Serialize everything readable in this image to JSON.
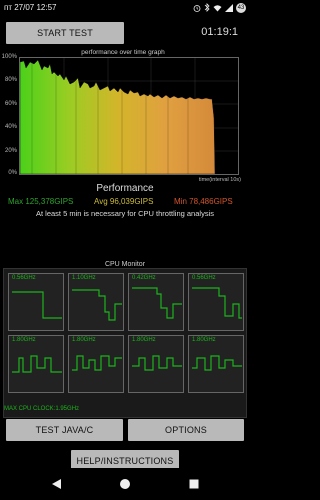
{
  "status_bar": {
    "time": "пт 27/07 12:57",
    "battery": "43",
    "icons": [
      "alarm-icon",
      "bluetooth-icon",
      "wifi-icon",
      "signal-icon"
    ]
  },
  "header": {
    "start_button": "START TEST",
    "timer": "01:19:1"
  },
  "graph": {
    "title": "performance over time graph",
    "y_labels": [
      "100%",
      "80%",
      "60%",
      "40%",
      "20%",
      "0%"
    ],
    "x_label": "time(interval 10s)"
  },
  "performance": {
    "title": "Performance",
    "max": "Max 125,378GIPS",
    "avg": "Avg 96,039GIPS",
    "min": "Min 78,486GIPS",
    "note": "At least 5 min is necessary for CPU throttling analysis",
    "colors": {
      "max": "#2ea32e",
      "avg": "#cdbb3a",
      "min": "#d4552b"
    }
  },
  "cpu_monitor": {
    "title": "CPU Monitor",
    "cores": [
      {
        "freq": "0.56GHz"
      },
      {
        "freq": "1.10GHz"
      },
      {
        "freq": "0.42GHz"
      },
      {
        "freq": "0.56GHz"
      },
      {
        "freq": "1.80GHz"
      },
      {
        "freq": "1.80GHz"
      },
      {
        "freq": "1.80GHz"
      },
      {
        "freq": "1.80GHz"
      }
    ],
    "max_clock": "MAX CPU CLOCK:1.95GHz"
  },
  "buttons": {
    "test_java": "TEST JAVA/C",
    "options": "OPTIONS",
    "help": "HELP/INSTRUCTIONS"
  },
  "nav": [
    "back-icon",
    "home-icon",
    "recents-icon"
  ]
}
